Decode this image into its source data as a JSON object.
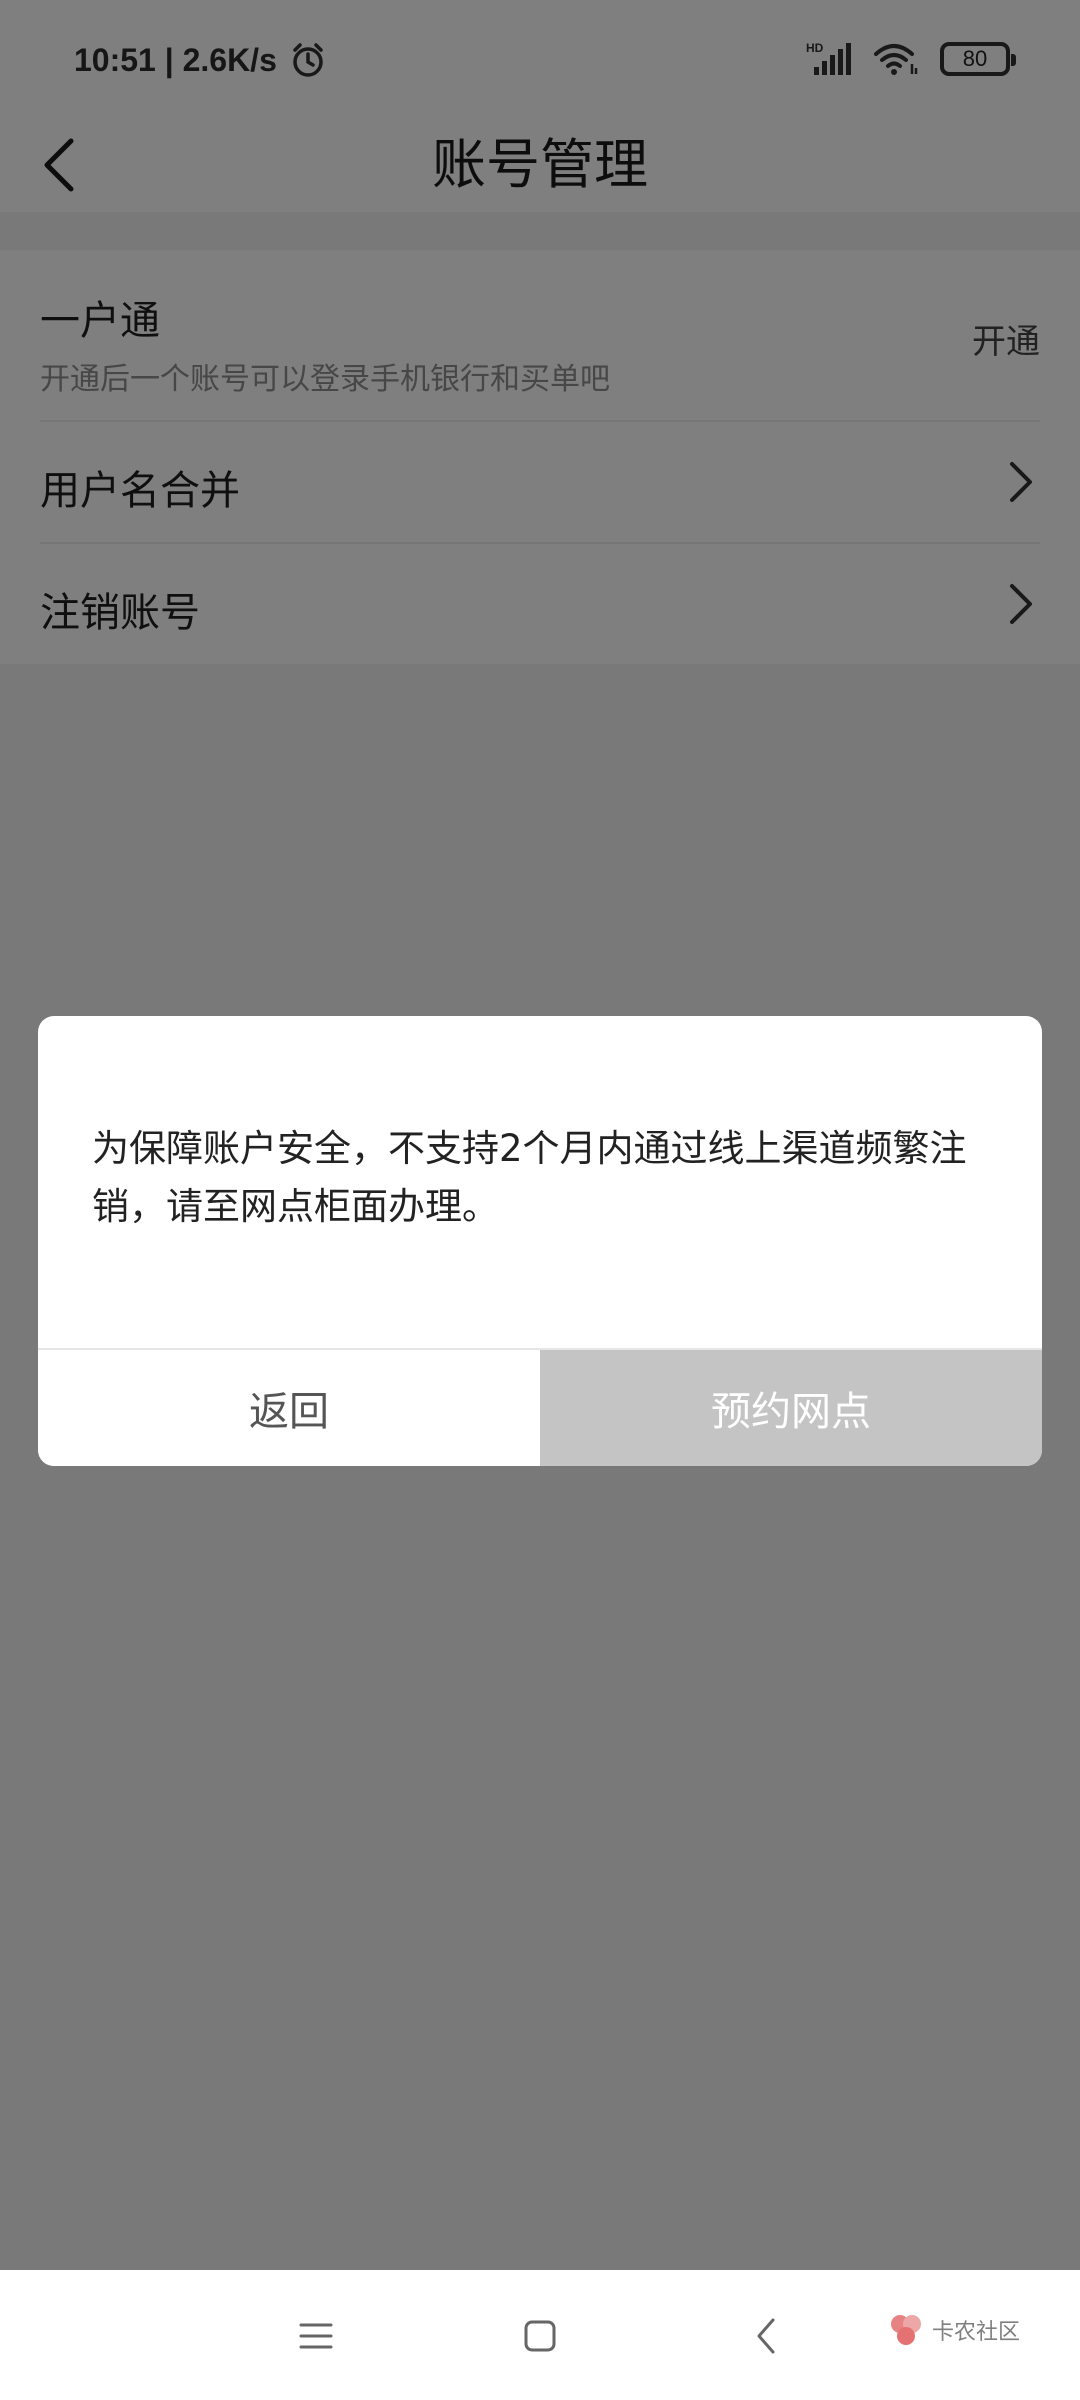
{
  "status_bar": {
    "time": "10:51",
    "net_speed": "2.6K/s",
    "network_badge": "HD",
    "battery": "80",
    "icons": [
      "alarm-icon",
      "signal-icon",
      "wifi-icon",
      "battery-icon"
    ]
  },
  "header": {
    "title": "账号管理"
  },
  "settings": {
    "items": [
      {
        "title": "一户通",
        "subtitle": "开通后一个账号可以登录手机银行和买单吧",
        "action": "开通"
      },
      {
        "title": "用户名合并"
      },
      {
        "title": "注销账号"
      }
    ]
  },
  "dialog": {
    "message": "为保障账户安全，不支持2个月内通过线上渠道频繁注销，请至网点柜面办理。",
    "cancel_label": "返回",
    "confirm_label": "预约网点"
  },
  "watermark": {
    "text": "卡农社区"
  },
  "colors": {
    "overlay": "rgba(0,0,0,0.5)",
    "background": "#f3f3f3",
    "confirm_button": "#c4c4c4"
  }
}
